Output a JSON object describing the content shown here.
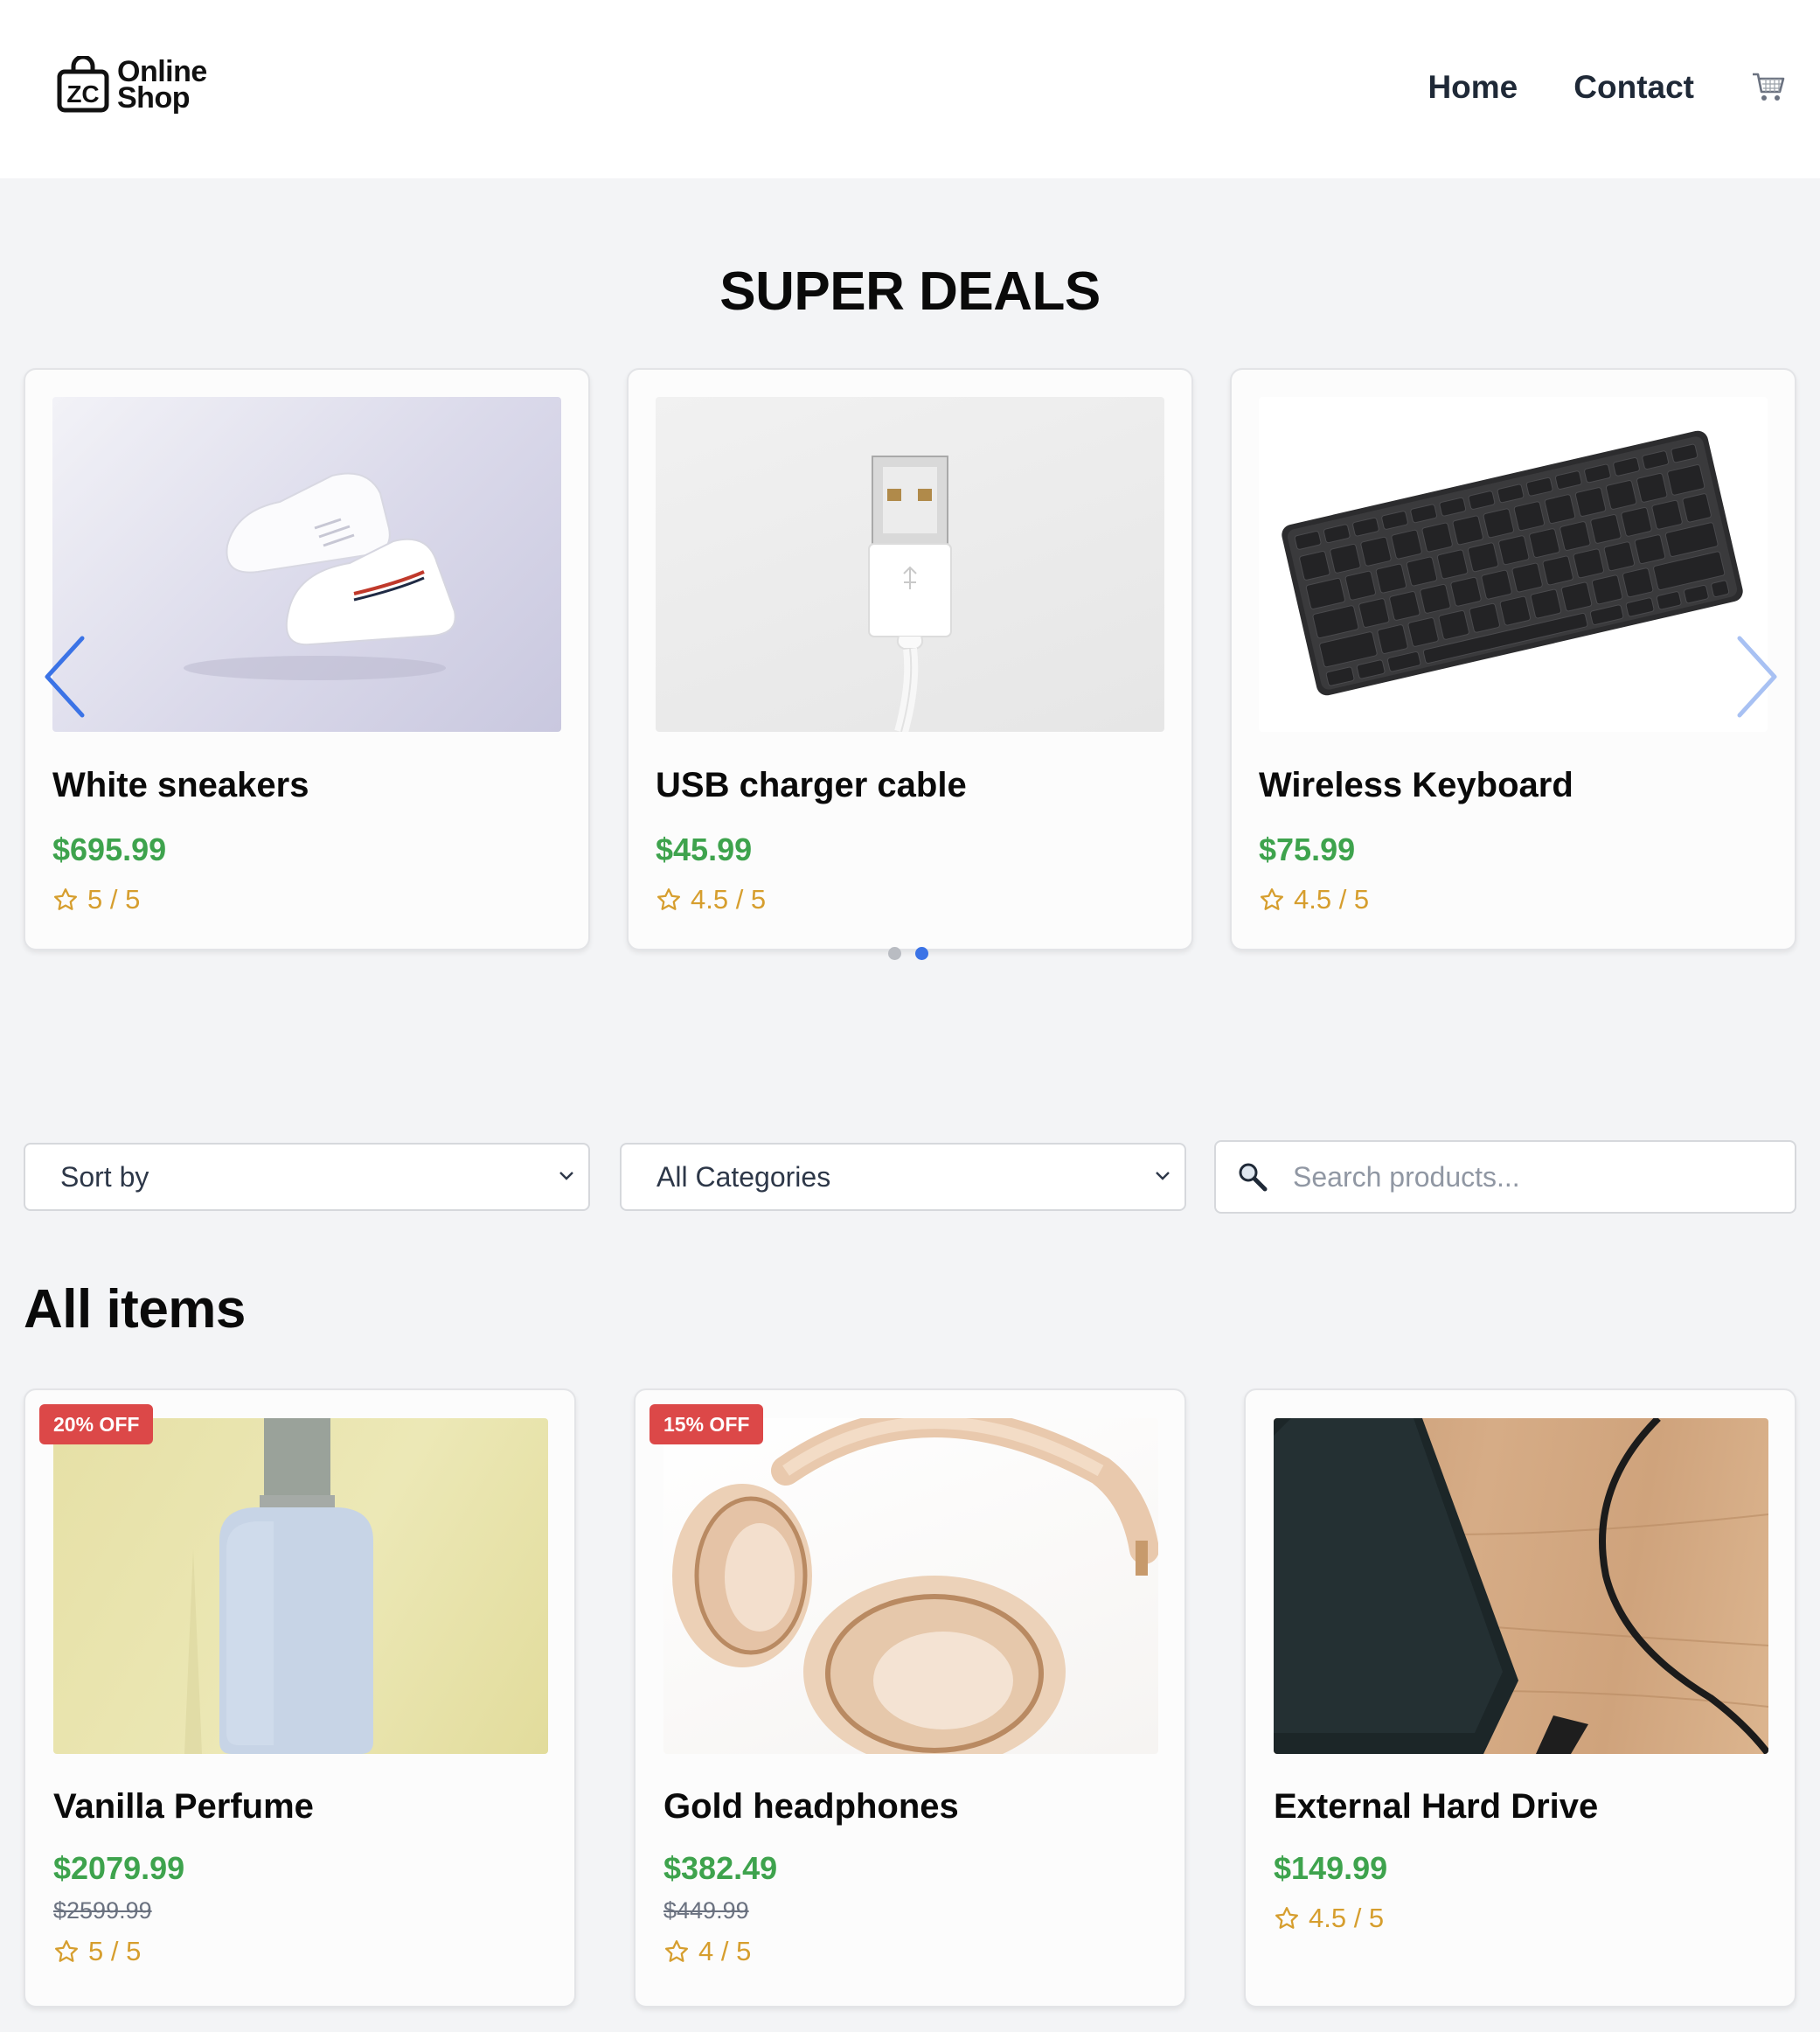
{
  "header": {
    "logo_monogram": "ZC",
    "logo_line1": "Online",
    "logo_line2": "Shop",
    "nav": [
      {
        "label": "Home"
      },
      {
        "label": "Contact"
      }
    ],
    "cart_icon": "cart-icon"
  },
  "deals": {
    "title": "SUPER DEALS",
    "carousel": {
      "slide_count": 2,
      "active_slide": 2
    },
    "items": [
      {
        "name": "White sneakers",
        "price": "$695.99",
        "rating": "5 / 5",
        "image": "white-sneakers-photo"
      },
      {
        "name": "USB charger cable",
        "price": "$45.99",
        "rating": "4.5 / 5",
        "image": "usb-cable-photo"
      },
      {
        "name": "Wireless Keyboard",
        "price": "$75.99",
        "rating": "4.5 / 5",
        "image": "keyboard-photo"
      }
    ]
  },
  "filters": {
    "sort_label": "Sort by",
    "category_label": "All Categories",
    "search_placeholder": "Search products..."
  },
  "all_items": {
    "title": "All items",
    "items": [
      {
        "name": "Vanilla Perfume",
        "badge": "20% OFF",
        "price": "$2079.99",
        "old_price": "$2599.99",
        "rating": "5 / 5",
        "image": "perfume-photo"
      },
      {
        "name": "Gold headphones",
        "badge": "15% OFF",
        "price": "$382.49",
        "old_price": "$449.99",
        "rating": "4 / 5",
        "image": "headphones-photo"
      },
      {
        "name": "External Hard Drive",
        "price": "$149.99",
        "rating": "4.5 / 5",
        "image": "hard-drive-photo"
      }
    ]
  },
  "colors": {
    "price": "#3ea34d",
    "rating": "#d69e2e",
    "badge": "#dc4848",
    "accent": "#3b73e6"
  }
}
